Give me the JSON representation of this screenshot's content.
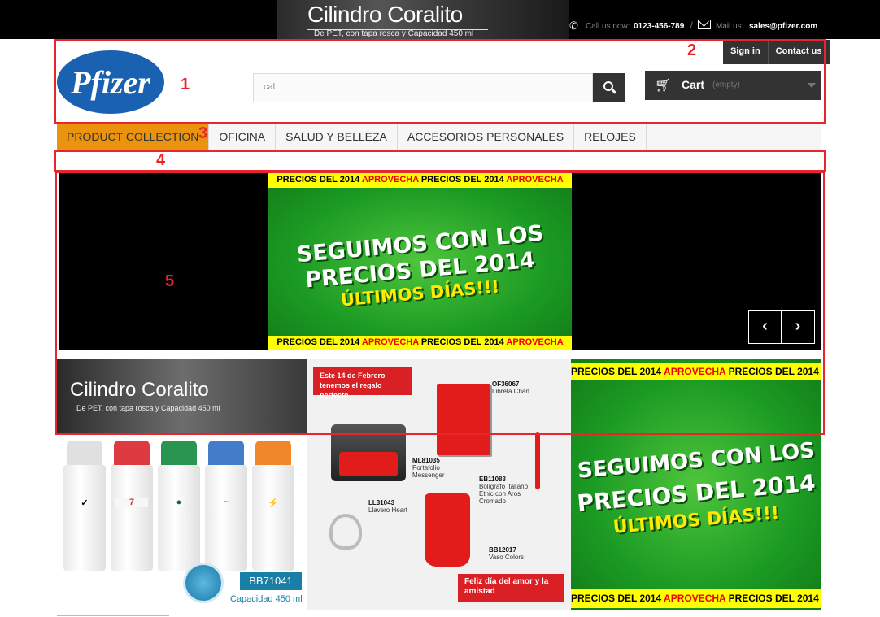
{
  "topbar": {
    "banner_title": "Cilindro Coralito",
    "banner_subtitle": "De PET, con tapa rosca y Capacidad 450 ml",
    "call_label": "Call us now:",
    "phone": "0123-456-789",
    "mail_label": "Mail us:",
    "email": "sales@pfizer.com"
  },
  "header": {
    "logo_text": "Pfizer",
    "search_value": "cal",
    "sign_in": "Sign in",
    "contact_us": "Contact us",
    "cart_label": "Cart",
    "cart_status": "(empty)"
  },
  "nav": {
    "items": [
      {
        "label": "PRODUCT COLLECTION"
      },
      {
        "label": "OFICINA"
      },
      {
        "label": "SALUD Y BELLEZA"
      },
      {
        "label": "ACCESORIOS PERSONALES"
      },
      {
        "label": "RELOJES"
      }
    ]
  },
  "promo": {
    "strip_a": "PRECIOS DEL 2014 ",
    "strip_b": "APROVECHA",
    "headline_1": "SEGUIMOS CON LOS",
    "headline_2": "PRECIOS DEL 2014",
    "headline_3": "ÚLTIMOS DÍAS!!!"
  },
  "banner1": {
    "title": "Cilindro Coralito",
    "subtitle": "De PET, con tapa rosca y Capacidad 450 ml",
    "code": "BB71041",
    "capacity": "Capacidad 450 ml"
  },
  "banner2": {
    "ribbon": "Este 14 de Febrero tenemos el regalo perfecto",
    "items": [
      {
        "code": "OF36067",
        "name": "Libreta Chart"
      },
      {
        "code": "ML81035",
        "name": "Portafolio Messenger"
      },
      {
        "code": "EB11083",
        "name": "Bolígrafo Italiano Ethic con Aros Cromado"
      },
      {
        "code": "LL31043",
        "name": "Llavero Heart"
      },
      {
        "code": "BB12017",
        "name": "Vaso Colors"
      }
    ],
    "footer": "Feliz día del amor y la amistad"
  },
  "annotations": [
    "1",
    "2",
    "3",
    "4",
    "5"
  ],
  "colors": {
    "accent": "#e9930f",
    "dark": "#333333",
    "annotation": "#e8242d",
    "promo_green": "#1b9a23",
    "promo_yellow": "#ffff00"
  }
}
